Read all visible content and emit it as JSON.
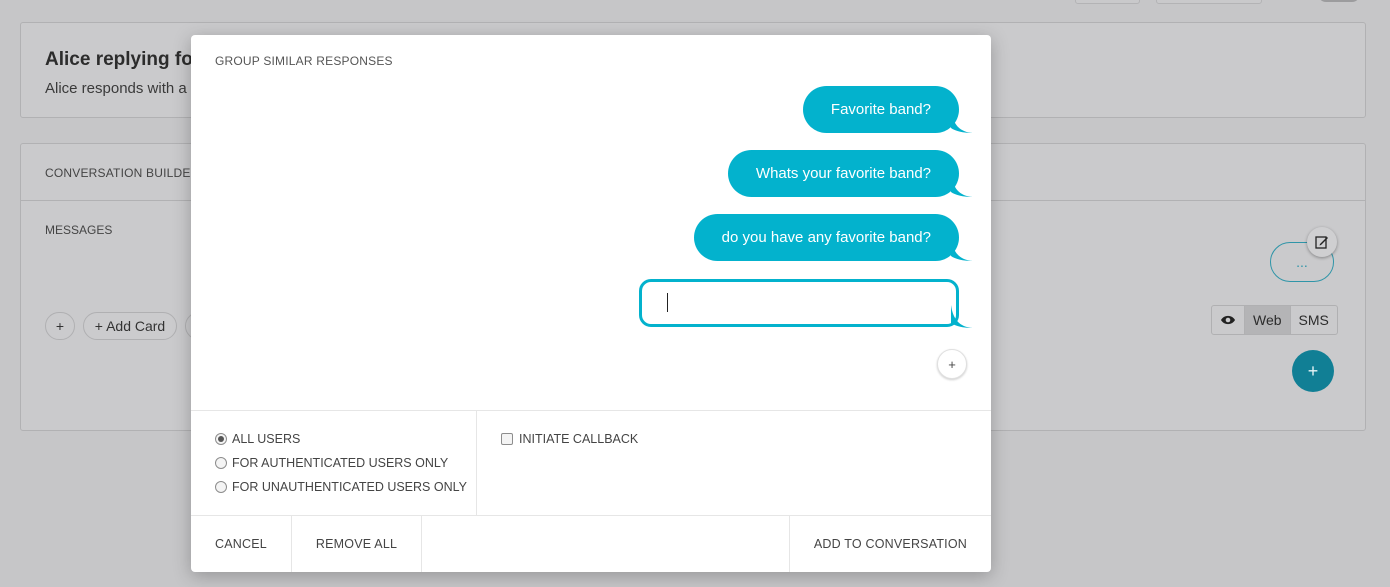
{
  "background": {
    "header": {
      "title": "Alice replying fo",
      "subtitle": "Alice responds with a"
    },
    "builder": {
      "title": "CONVERSATION BUILDER",
      "messages_label": "MESSAGES",
      "plus_label": "+",
      "add_card_label": "+  Add Card",
      "more_label": "...",
      "view_toggle": {
        "eye_icon": "eye-icon",
        "web_label": "Web",
        "sms_label": "SMS",
        "active": "Web"
      },
      "add_fab_label": "+"
    }
  },
  "modal": {
    "title": "GROUP SIMILAR RESPONSES",
    "responses": [
      "Favorite band?",
      "Whats your favorite band?",
      "do you have any favorite band?"
    ],
    "new_response_value": "",
    "add_response_label": "+",
    "audience": {
      "options": [
        "ALL USERS",
        "FOR AUTHENTICATED USERS ONLY",
        "FOR UNAUTHENTICATED USERS ONLY"
      ],
      "selected": "ALL USERS"
    },
    "initiate_callback": {
      "label": "INITIATE CALLBACK",
      "checked": false
    },
    "footer": {
      "cancel_label": "CANCEL",
      "remove_all_label": "REMOVE ALL",
      "add_label": "ADD TO CONVERSATION"
    }
  },
  "colors": {
    "accent": "#03b2cd",
    "fab": "#117f95",
    "overlay_background": "#c6c6c8"
  }
}
